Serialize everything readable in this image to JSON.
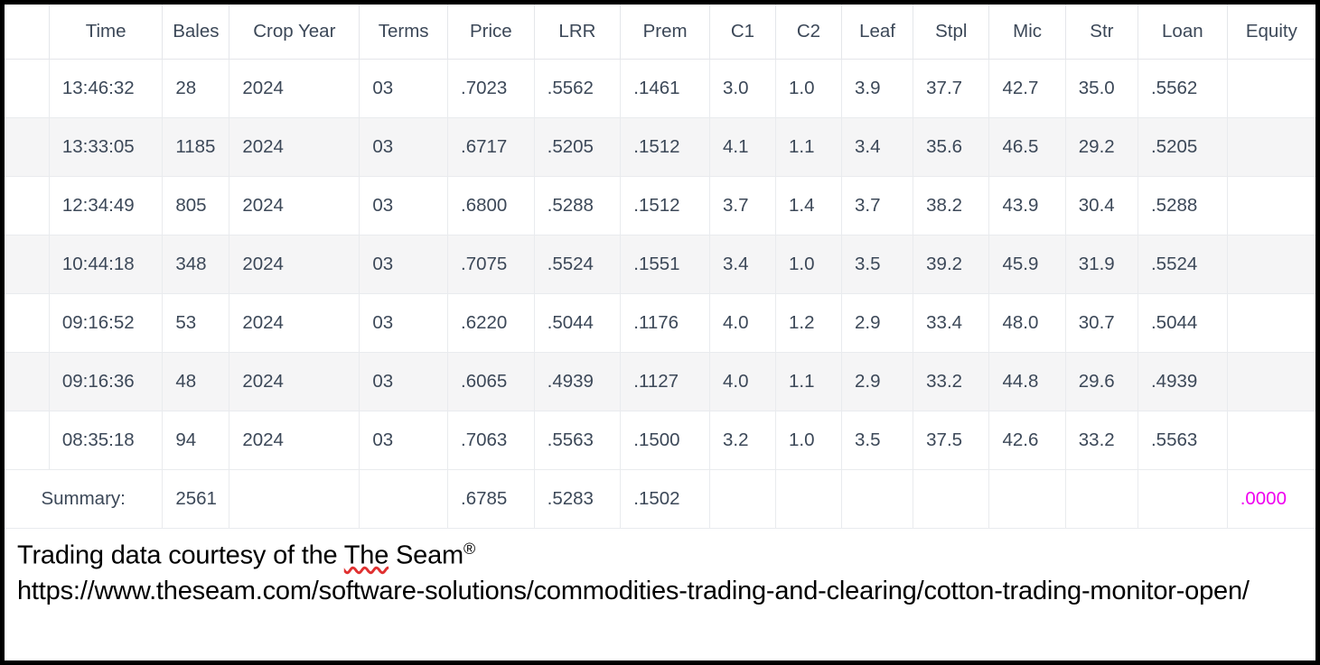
{
  "table": {
    "columns": [
      {
        "key": "blank",
        "label": ""
      },
      {
        "key": "time",
        "label": "Time"
      },
      {
        "key": "bales",
        "label": "Bales"
      },
      {
        "key": "crop",
        "label": "Crop Year"
      },
      {
        "key": "terms",
        "label": "Terms"
      },
      {
        "key": "price",
        "label": "Price"
      },
      {
        "key": "lrr",
        "label": "LRR"
      },
      {
        "key": "prem",
        "label": "Prem"
      },
      {
        "key": "c1",
        "label": "C1"
      },
      {
        "key": "c2",
        "label": "C2"
      },
      {
        "key": "leaf",
        "label": "Leaf"
      },
      {
        "key": "stpl",
        "label": "Stpl"
      },
      {
        "key": "mic",
        "label": "Mic"
      },
      {
        "key": "str",
        "label": "Str"
      },
      {
        "key": "loan",
        "label": "Loan"
      },
      {
        "key": "equity",
        "label": "Equity"
      }
    ],
    "rows": [
      {
        "time": "13:46:32",
        "bales": "28",
        "crop": "2024",
        "terms": "03",
        "price": ".7023",
        "lrr": ".5562",
        "prem": ".1461",
        "c1": "3.0",
        "c2": "1.0",
        "leaf": "3.9",
        "stpl": "37.7",
        "mic": "42.7",
        "str": "35.0",
        "loan": ".5562",
        "equity": ""
      },
      {
        "time": "13:33:05",
        "bales": "1185",
        "crop": "2024",
        "terms": "03",
        "price": ".6717",
        "lrr": ".5205",
        "prem": ".1512",
        "c1": "4.1",
        "c2": "1.1",
        "leaf": "3.4",
        "stpl": "35.6",
        "mic": "46.5",
        "str": "29.2",
        "loan": ".5205",
        "equity": ""
      },
      {
        "time": "12:34:49",
        "bales": "805",
        "crop": "2024",
        "terms": "03",
        "price": ".6800",
        "lrr": ".5288",
        "prem": ".1512",
        "c1": "3.7",
        "c2": "1.4",
        "leaf": "3.7",
        "stpl": "38.2",
        "mic": "43.9",
        "str": "30.4",
        "loan": ".5288",
        "equity": ""
      },
      {
        "time": "10:44:18",
        "bales": "348",
        "crop": "2024",
        "terms": "03",
        "price": ".7075",
        "lrr": ".5524",
        "prem": ".1551",
        "c1": "3.4",
        "c2": "1.0",
        "leaf": "3.5",
        "stpl": "39.2",
        "mic": "45.9",
        "str": "31.9",
        "loan": ".5524",
        "equity": ""
      },
      {
        "time": "09:16:52",
        "bales": "53",
        "crop": "2024",
        "terms": "03",
        "price": ".6220",
        "lrr": ".5044",
        "prem": ".1176",
        "c1": "4.0",
        "c2": "1.2",
        "leaf": "2.9",
        "stpl": "33.4",
        "mic": "48.0",
        "str": "30.7",
        "loan": ".5044",
        "equity": ""
      },
      {
        "time": "09:16:36",
        "bales": "48",
        "crop": "2024",
        "terms": "03",
        "price": ".6065",
        "lrr": ".4939",
        "prem": ".1127",
        "c1": "4.0",
        "c2": "1.1",
        "leaf": "2.9",
        "stpl": "33.2",
        "mic": "44.8",
        "str": "29.6",
        "loan": ".4939",
        "equity": ""
      },
      {
        "time": "08:35:18",
        "bales": "94",
        "crop": "2024",
        "terms": "03",
        "price": ".7063",
        "lrr": ".5563",
        "prem": ".1500",
        "c1": "3.2",
        "c2": "1.0",
        "leaf": "3.5",
        "stpl": "37.5",
        "mic": "42.6",
        "str": "33.2",
        "loan": ".5563",
        "equity": ""
      }
    ],
    "summary": {
      "label": "Summary:",
      "bales": "2561",
      "crop": "",
      "terms": "",
      "price": ".6785",
      "lrr": ".5283",
      "prem": ".1502",
      "c1": "",
      "c2": "",
      "leaf": "",
      "stpl": "",
      "mic": "",
      "str": "",
      "loan": "",
      "equity": ".0000",
      "equity_color": "#ef00ef"
    }
  },
  "footer": {
    "credit_before": "Trading data courtesy of the ",
    "credit_misspelled": "The",
    "credit_after": " Seam",
    "registered_mark": "®",
    "url": "https://www.theseam.com/software-solutions/commodities-trading-and-clearing/cotton-trading-monitor-open/"
  }
}
